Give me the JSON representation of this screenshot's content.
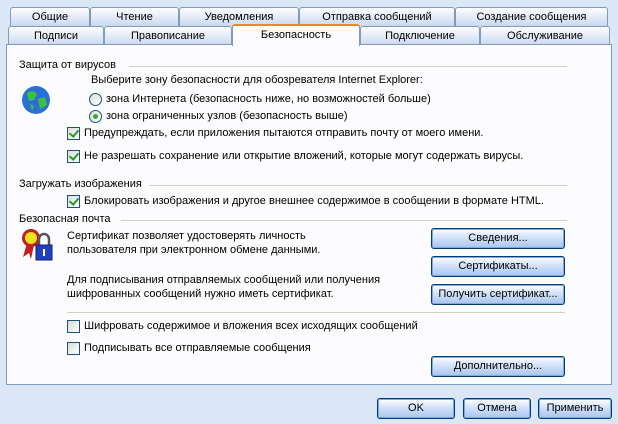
{
  "tabs_row1": [
    "Общие",
    "Чтение",
    "Уведомления",
    "Отправка сообщений",
    "Создание сообщения"
  ],
  "tabs_row2": [
    "Подписи",
    "Правописание",
    "Безопасность",
    "Подключение",
    "Обслуживание"
  ],
  "virus": {
    "title": "Защита от вирусов",
    "zone_prompt": "Выберите зону безопасности для обозревателя Internet Explorer:",
    "zone_internet": "зона Интернета (безопасность ниже, но возможностей больше)",
    "zone_restricted": "зона ограниченных узлов (безопасность выше)",
    "selected_zone": "restricted",
    "warn_send": "Предупреждать, если приложения пытаются отправить почту от моего имени.",
    "warn_send_checked": true,
    "block_attach": "Не разрешать сохранение или открытие вложений, которые могут содержать вирусы.",
    "block_attach_checked": true
  },
  "images": {
    "title": "Загружать изображения",
    "block": "Блокировать изображения и другое внешнее содержимое в сообщении в формате HTML.",
    "block_checked": true
  },
  "secure_mail": {
    "title": "Безопасная почта",
    "text1_line1": "Сертификат позволяет удостоверять личность",
    "text1_line2": "пользователя при электронном обмене данными.",
    "text2_line1": "Для подписывания отправляемых сообщений или получения",
    "text2_line2": "шифрованных сообщений нужно иметь сертификат.",
    "btn_details": "Сведения...",
    "btn_certs": "Сертификаты...",
    "btn_get": "Получить сертификат...",
    "encrypt": "Шифровать содержимое и вложения всех исходящих сообщений",
    "encrypt_checked": false,
    "sign": "Подписывать все отправляемые сообщения",
    "sign_checked": false,
    "btn_advanced": "Дополнительно..."
  },
  "footer": {
    "ok": "OK",
    "cancel": "Отмена",
    "apply": "Применить"
  }
}
